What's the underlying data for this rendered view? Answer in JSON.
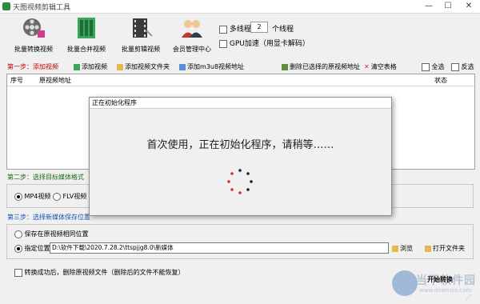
{
  "window": {
    "title": "天图视频剪辑工具",
    "minimize": "—",
    "maximize": "☐",
    "close": "✕"
  },
  "toolbar": [
    {
      "label": "批量转换视频",
      "icon": "film-reel-icon"
    },
    {
      "label": "批量合并视频",
      "icon": "film-merge-icon"
    },
    {
      "label": "批量剪辑视频",
      "icon": "film-cut-icon"
    },
    {
      "label": "会员管理中心",
      "icon": "members-icon"
    }
  ],
  "options": {
    "multithread_label": "多线程",
    "thread_count": "2",
    "thread_suffix": "个线程",
    "gpu_label": "GPU加速（用显卡解码）"
  },
  "step1": {
    "prefix": "第一步：",
    "text": "添加视频",
    "add_video": "添加视频",
    "add_folder": "添加视频文件夹",
    "add_m3u8": "添加m3u8视频地址",
    "delete_selected": "删除已选择的原视频地址",
    "clear_table": "清空表格",
    "select_all": "全选",
    "invert_select": "反选"
  },
  "table": {
    "col_index": "序号",
    "col_path": "原视频地址",
    "col_status": "状态"
  },
  "step2": {
    "label": "第二步：选择目标媒体格式",
    "mp4": "MP4视频",
    "flv": "FLV视频"
  },
  "step3": {
    "label": "第三步：选择新媒体保存位置",
    "same_location": "保存在原视频相同位置",
    "specify": "指定位置",
    "path": "D:\\软件下载\\2020.7.28.2\\ttspjjg8.0\\新媒体",
    "browse": "浏览",
    "open_folder": "打开文件夹"
  },
  "footer": {
    "delete_after": "转换成功后，删除原视频文件（删除后的文件不能恢复）",
    "start": "开始转换",
    "watermark": "当下软件园",
    "watermark_url": "www.downxia.com"
  },
  "dialog": {
    "title": "正在初始化程序",
    "message": "首次使用，正在初始化程序，请稍等……"
  }
}
